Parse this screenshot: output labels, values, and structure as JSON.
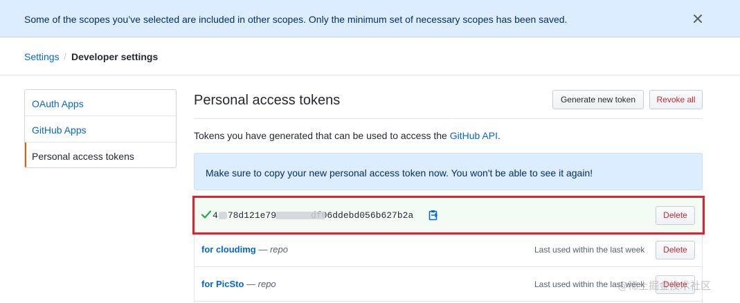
{
  "flash": {
    "message": "Some of the scopes you’ve selected are included in other scopes. Only the minimum set of necessary scopes has been saved.",
    "close_glyph": "✕"
  },
  "breadcrumb": {
    "parent": "Settings",
    "separator": "/",
    "current": "Developer settings"
  },
  "sidebar": {
    "items": [
      {
        "label": "OAuth Apps"
      },
      {
        "label": "GitHub Apps"
      },
      {
        "label": "Personal access tokens"
      }
    ]
  },
  "main": {
    "title": "Personal access tokens",
    "generate_label": "Generate new token",
    "revoke_label": "Revoke all",
    "description_prefix": "Tokens you have generated that can be used to access the ",
    "description_link": "GitHub API",
    "description_suffix": ".",
    "notice": "Make sure to copy your new personal access token now. You won't be able to see it again!"
  },
  "tokens": {
    "new_token": {
      "value_start": "4",
      "value_middle": "78d121e79",
      "value_end": "df06ddebd056b627b2a",
      "delete_label": "Delete"
    },
    "rows": [
      {
        "name": "for cloudimg",
        "scope": " — repo",
        "last_used": "Last used within the last week",
        "delete_label": "Delete"
      },
      {
        "name": "for PicSto",
        "scope": " — repo",
        "last_used": "Last used within the last week",
        "delete_label": "Delete"
      }
    ]
  },
  "watermark": "@稀土掘金技术社区",
  "colors": {
    "link": "#0366d6",
    "danger": "#cb2431",
    "flash_bg": "#dbedff",
    "highlight": "#e3212b",
    "success": "#28a745"
  }
}
